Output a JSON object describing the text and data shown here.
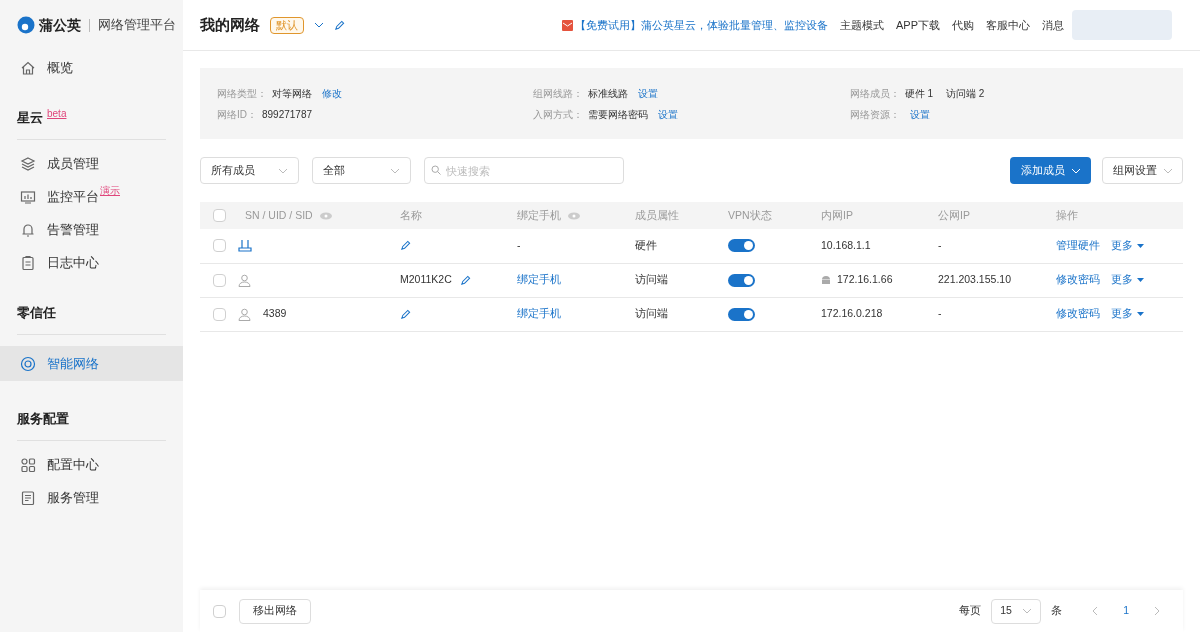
{
  "brand": {
    "name": "蒲公英",
    "subtitle": "网络管理平台"
  },
  "sidebar": {
    "items": [
      {
        "kind": "item",
        "label": "概览",
        "selected": false
      },
      {
        "kind": "section",
        "label": "星云",
        "badge": "beta"
      },
      {
        "kind": "item",
        "label": "成员管理",
        "selected": false
      },
      {
        "kind": "item",
        "label": "监控平台",
        "badge": "演示",
        "selected": false
      },
      {
        "kind": "item",
        "label": "告警管理",
        "selected": false
      },
      {
        "kind": "item",
        "label": "日志中心",
        "selected": false
      },
      {
        "kind": "section",
        "label": "零信任"
      },
      {
        "kind": "item",
        "label": "智能网络",
        "selected": true
      },
      {
        "kind": "section",
        "label": "服务配置"
      },
      {
        "kind": "item",
        "label": "配置中心",
        "selected": false
      },
      {
        "kind": "item",
        "label": "服务管理",
        "selected": false
      }
    ]
  },
  "header": {
    "title": "我的网络",
    "tag": "默认",
    "promo": "【免费试用】蒲公英星云，体验批量管理、监控设备",
    "links": [
      "主题模式",
      "APP下载",
      "代购",
      "客服中心",
      "消息"
    ]
  },
  "info": [
    {
      "label": "网络类型：",
      "value": "对等网络",
      "link": "修改"
    },
    {
      "label": "组网线路：",
      "value": "标准线路",
      "link": "设置"
    },
    {
      "label": "网络成员：",
      "value": "硬件 1",
      "value2": "访问端 2"
    },
    {
      "label": "网络ID：",
      "value": "899271787"
    },
    {
      "label": "入网方式：",
      "value": "需要网络密码",
      "link": "设置"
    },
    {
      "label": "网络资源：",
      "link": "设置"
    }
  ],
  "filters": {
    "member": "所有成员",
    "status": "全部",
    "search_placeholder": "快速搜索"
  },
  "buttons": {
    "add": "添加成员",
    "settings": "组网设置"
  },
  "table": {
    "all_checked": false,
    "columns": [
      "SN / UID / SID",
      "名称",
      "绑定手机",
      "成员属性",
      "VPN状态",
      "内网IP",
      "公网IP",
      "操作"
    ],
    "rows": [
      {
        "kind": "hardware",
        "checked": false,
        "sn": "",
        "name": "",
        "phone": "-",
        "phone_link": false,
        "type": "硬件",
        "vpn_on": true,
        "lan_ip": "10.168.1.1",
        "android": false,
        "wan_ip": "-",
        "action": "管理硬件",
        "more": "更多"
      },
      {
        "kind": "user",
        "checked": false,
        "sn": "",
        "name": "M2011K2C",
        "phone": "绑定手机",
        "phone_link": true,
        "type": "访问端",
        "vpn_on": true,
        "lan_ip": "172.16.1.66",
        "android": true,
        "wan_ip": "221.203.155.10",
        "action": "修改密码",
        "more": "更多"
      },
      {
        "kind": "user",
        "checked": false,
        "sn": "4389",
        "name": "",
        "phone": "绑定手机",
        "phone_link": true,
        "type": "访问端",
        "vpn_on": true,
        "lan_ip": "172.16.0.218",
        "android": false,
        "wan_ip": "-",
        "action": "修改密码",
        "more": "更多"
      }
    ]
  },
  "footer": {
    "checked": false,
    "remove": "移出网络",
    "per_page": "每页",
    "page_size": "15",
    "unit": "条",
    "page": "1"
  }
}
